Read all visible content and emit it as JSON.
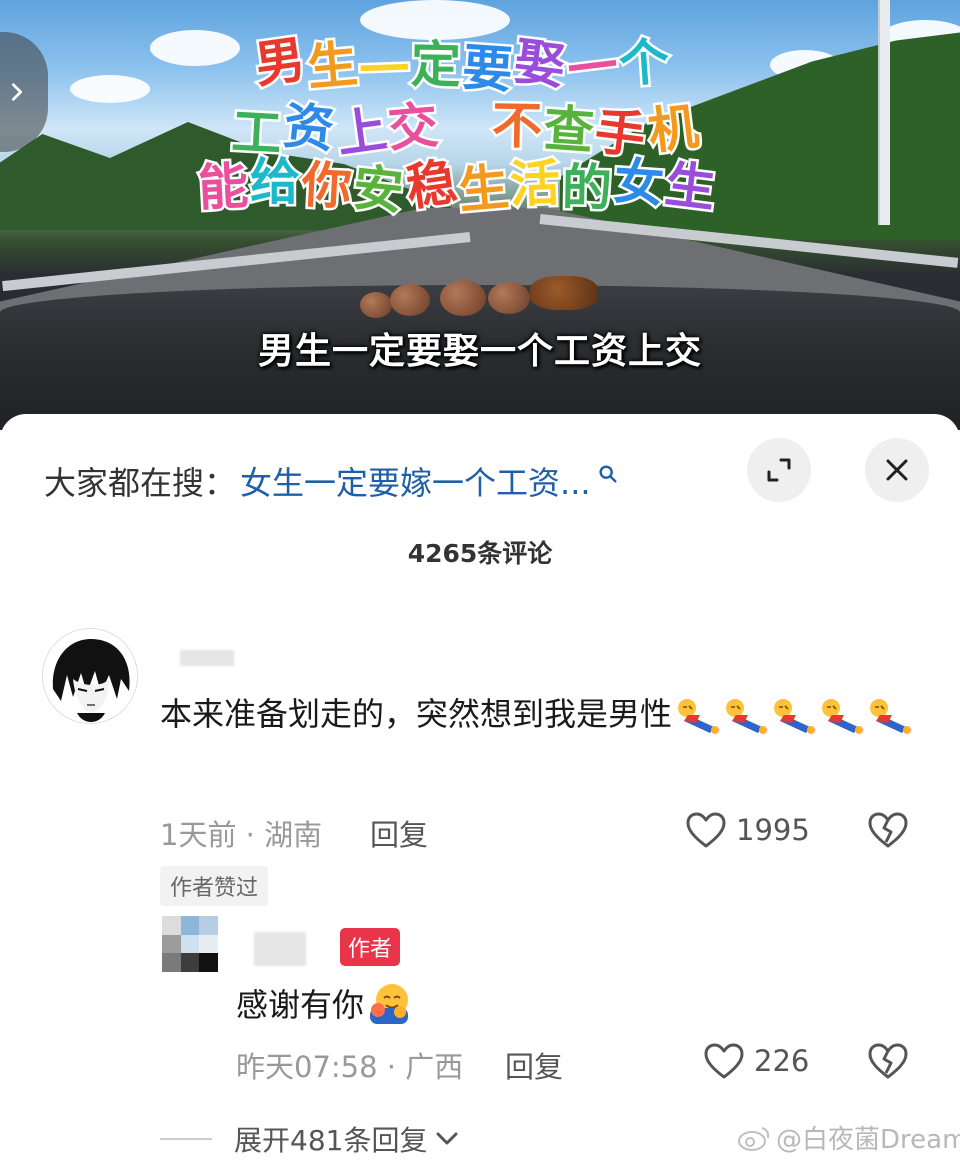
{
  "video": {
    "overlay_lines": [
      [
        "男",
        "生",
        "一",
        "定",
        "要",
        "娶",
        "一",
        "个"
      ],
      [
        "工",
        "资",
        "上",
        "交",
        "　",
        "不",
        "查",
        "手",
        "机"
      ],
      [
        "能",
        "给",
        "你",
        "安",
        "稳",
        "生",
        "活",
        "的",
        "女",
        "生"
      ]
    ],
    "overlay_colors": [
      "#e8392e",
      "#f39a1e",
      "#ffd21f",
      "#3db15a",
      "#2d8ae8",
      "#9a4ddb",
      "#ea4f9e",
      "#1bb9c9",
      "#f06a2c",
      "#57b33b"
    ],
    "caption": "男生一定要娶一个工资上交"
  },
  "search": {
    "prefix": "大家都在搜：",
    "query": "女生一定要嫁一个工资..."
  },
  "comments_count": "4265条评论",
  "comment": {
    "text": "本来准备划走的，突然想到我是男性",
    "time_location": "1天前 · 湖南",
    "reply_label": "回复",
    "likes": "1995",
    "author_liked": "作者赞过",
    "emoji_count": 5
  },
  "reply": {
    "badge": "作者",
    "text": "感谢有你",
    "time_location": "昨天07:58 · 广西",
    "reply_label": "回复",
    "likes": "226"
  },
  "expand": {
    "label": "展开481条回复"
  },
  "watermark": "@白夜菌Dream"
}
